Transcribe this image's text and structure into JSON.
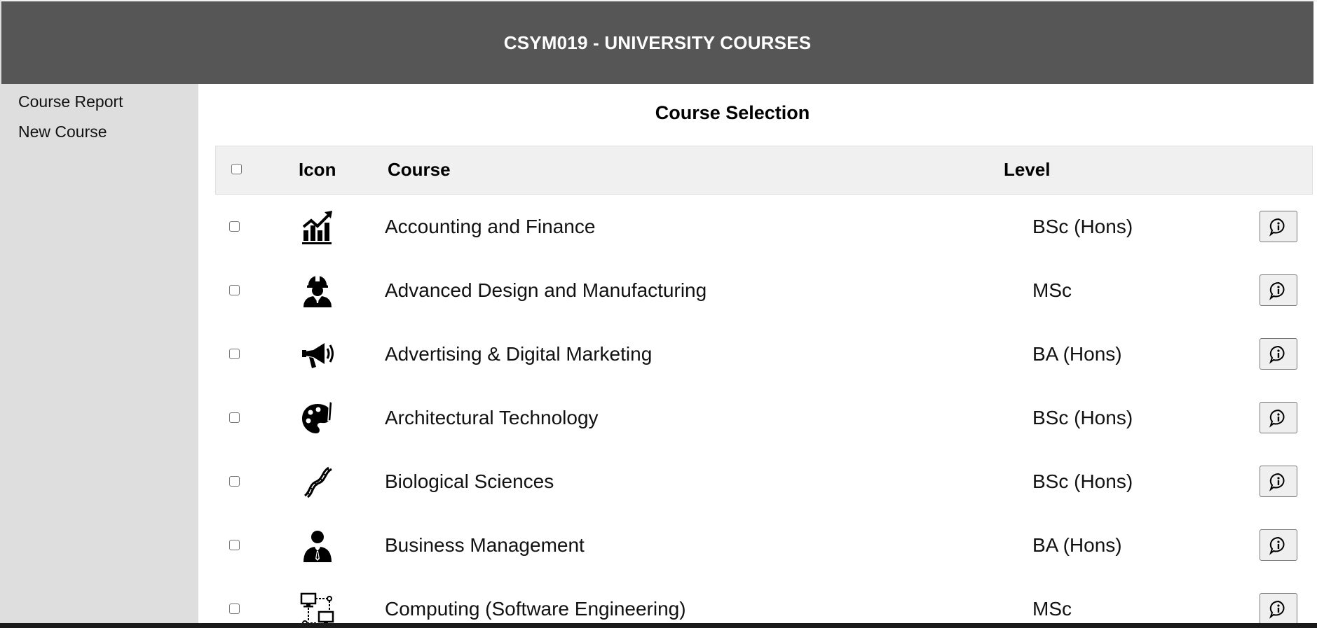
{
  "header": {
    "title": "CSYM019 - UNIVERSITY COURSES"
  },
  "sidebar": {
    "links": [
      {
        "label": "Course Report"
      },
      {
        "label": "New Course"
      }
    ]
  },
  "main": {
    "title": "Course Selection",
    "table": {
      "columns": {
        "icon": "Icon",
        "course": "Course",
        "level": "Level"
      },
      "rows": [
        {
          "icon": "finance-chart-icon",
          "course": "Accounting and Finance",
          "level": "BSc (Hons)"
        },
        {
          "icon": "engineer-helmet-icon",
          "course": "Advanced Design and Manufacturing",
          "level": "MSc"
        },
        {
          "icon": "megaphone-icon",
          "course": "Advertising & Digital Marketing",
          "level": "BA (Hons)"
        },
        {
          "icon": "palette-icon",
          "course": "Architectural Technology",
          "level": "BSc (Hons)"
        },
        {
          "icon": "dna-icon",
          "course": "Biological Sciences",
          "level": "BSc (Hons)"
        },
        {
          "icon": "business-person-icon",
          "course": "Business Management",
          "level": "BA (Hons)"
        },
        {
          "icon": "computer-network-icon",
          "course": "Computing (Software Engineering)",
          "level": "MSc"
        }
      ]
    },
    "row_action_icon": "info-speech-bubble-icon"
  }
}
